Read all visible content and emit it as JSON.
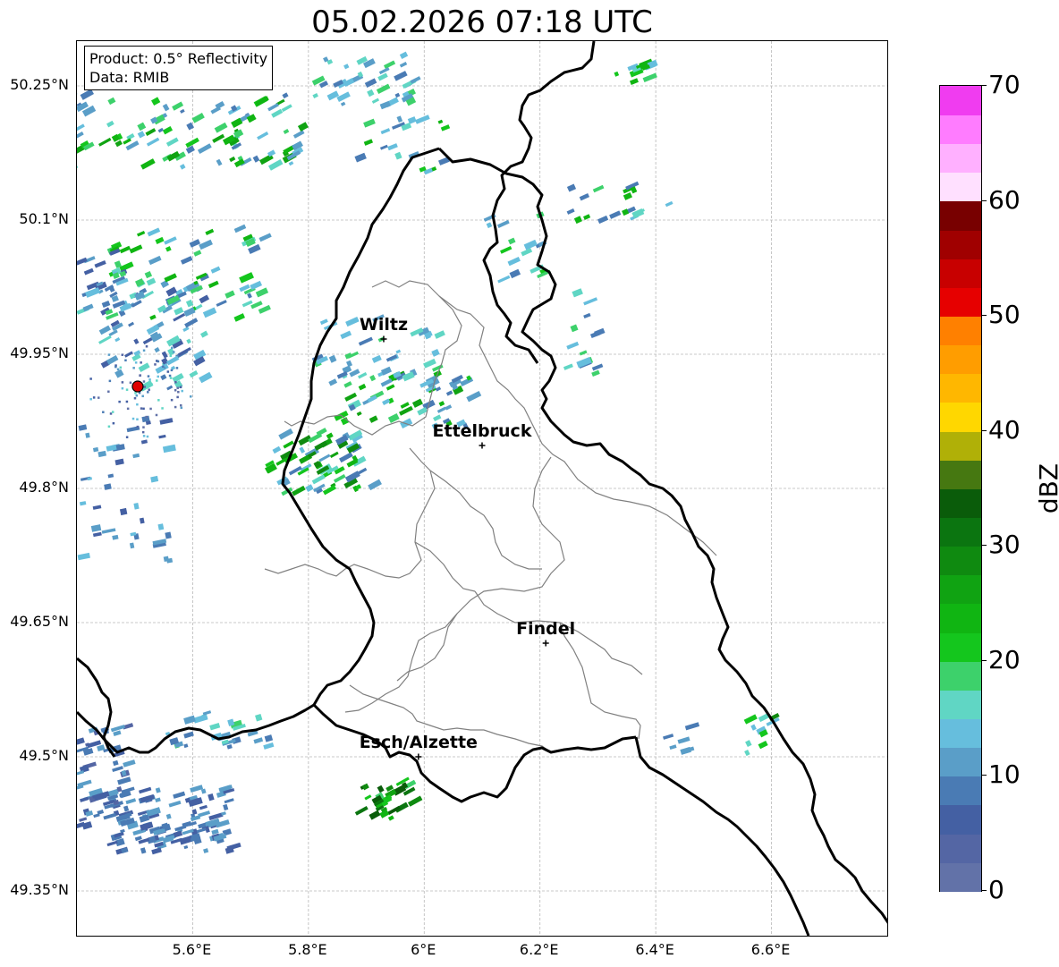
{
  "title": "05.02.2026 07:18 UTC",
  "info_box": {
    "product": "Product: 0.5° Reflectivity",
    "data_source": "Data: RMIB"
  },
  "lat_ticks": [
    "50.25°N",
    "50.1°N",
    "49.95°N",
    "49.8°N",
    "49.65°N",
    "49.5°N",
    "49.35°N"
  ],
  "lon_ticks": [
    "5.6°E",
    "5.8°E",
    "6°E",
    "6.2°E",
    "6.4°E",
    "6.6°E"
  ],
  "map_extent": {
    "lon_min": 5.4,
    "lon_max": 6.8,
    "lat_min": 49.3,
    "lat_max": 50.3
  },
  "cities": [
    {
      "name": "Wiltz",
      "lon": 5.93,
      "lat": 49.967
    },
    {
      "name": "Ettelbruck",
      "lon": 6.1,
      "lat": 49.848
    },
    {
      "name": "Findel",
      "lon": 6.21,
      "lat": 49.627
    },
    {
      "name": "Esch/Alzette",
      "lon": 5.99,
      "lat": 49.5
    }
  ],
  "radar_site": {
    "lon": 5.505,
    "lat": 49.914,
    "color": "#e00000"
  },
  "colorbar": {
    "label": "dBZ",
    "min": 0,
    "max": 70,
    "step": 2.5,
    "tick_labels": [
      "0",
      "10",
      "20",
      "30",
      "40",
      "50",
      "60",
      "70"
    ],
    "colors": [
      "#6272a8",
      "#5466a4",
      "#4460a3",
      "#4a7bb4",
      "#5a9ec8",
      "#66bedd",
      "#60d6c4",
      "#3dd16b",
      "#14c61d",
      "#10b512",
      "#10a312",
      "#0f8a10",
      "#0b7510",
      "#0a5c0a",
      "#467811",
      "#b0b007",
      "#ffd700",
      "#ffb700",
      "#ff9d00",
      "#ff8000",
      "#e60000",
      "#c80000",
      "#a00000",
      "#780000",
      "#ffe0ff",
      "#ffb0ff",
      "#ff7cff",
      "#f03cf0"
    ]
  },
  "colors": {
    "border": "#000000",
    "district": "#808080",
    "grid": "#b8b8b8"
  }
}
